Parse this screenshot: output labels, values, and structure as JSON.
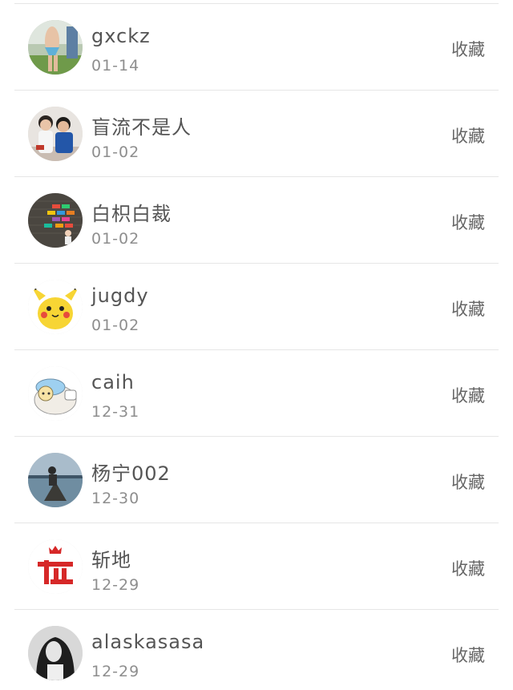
{
  "entries": [
    {
      "name": "gxckz",
      "date": "01-14",
      "action": "收藏",
      "avatar_icon": "swimsuit-photo-avatar"
    },
    {
      "name": "盲流不是人",
      "date": "01-02",
      "action": "收藏",
      "avatar_icon": "couple-photo-avatar"
    },
    {
      "name": "白枳白裁",
      "date": "01-02",
      "action": "收藏",
      "avatar_icon": "colorful-bricks-avatar"
    },
    {
      "name": "jugdy",
      "date": "01-02",
      "action": "收藏",
      "avatar_icon": "pikachu-avatar"
    },
    {
      "name": "caih",
      "date": "12-31",
      "action": "收藏",
      "avatar_icon": "cartoon-character-avatar"
    },
    {
      "name": "杨宁002",
      "date": "12-30",
      "action": "收藏",
      "avatar_icon": "boat-landscape-avatar"
    },
    {
      "name": "斩地",
      "date": "12-29",
      "action": "收藏",
      "avatar_icon": "red-text-logo-avatar"
    },
    {
      "name": "alaskasasa",
      "date": "12-29",
      "action": "收藏",
      "avatar_icon": "portrait-photo-avatar"
    }
  ],
  "colors": {
    "name_text": "#555555",
    "date_text": "#8e8e8e",
    "action_text": "#666666",
    "divider": "#e6e6e6"
  }
}
